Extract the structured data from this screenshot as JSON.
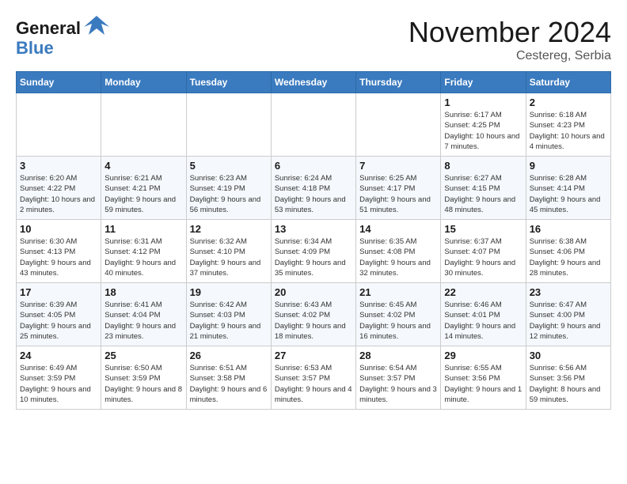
{
  "header": {
    "logo_line1": "General",
    "logo_line2": "Blue",
    "month": "November 2024",
    "location": "Cestereg, Serbia"
  },
  "days_of_week": [
    "Sunday",
    "Monday",
    "Tuesday",
    "Wednesday",
    "Thursday",
    "Friday",
    "Saturday"
  ],
  "weeks": [
    [
      {
        "num": "",
        "info": ""
      },
      {
        "num": "",
        "info": ""
      },
      {
        "num": "",
        "info": ""
      },
      {
        "num": "",
        "info": ""
      },
      {
        "num": "",
        "info": ""
      },
      {
        "num": "1",
        "info": "Sunrise: 6:17 AM\nSunset: 4:25 PM\nDaylight: 10 hours and 7 minutes."
      },
      {
        "num": "2",
        "info": "Sunrise: 6:18 AM\nSunset: 4:23 PM\nDaylight: 10 hours and 4 minutes."
      }
    ],
    [
      {
        "num": "3",
        "info": "Sunrise: 6:20 AM\nSunset: 4:22 PM\nDaylight: 10 hours and 2 minutes."
      },
      {
        "num": "4",
        "info": "Sunrise: 6:21 AM\nSunset: 4:21 PM\nDaylight: 9 hours and 59 minutes."
      },
      {
        "num": "5",
        "info": "Sunrise: 6:23 AM\nSunset: 4:19 PM\nDaylight: 9 hours and 56 minutes."
      },
      {
        "num": "6",
        "info": "Sunrise: 6:24 AM\nSunset: 4:18 PM\nDaylight: 9 hours and 53 minutes."
      },
      {
        "num": "7",
        "info": "Sunrise: 6:25 AM\nSunset: 4:17 PM\nDaylight: 9 hours and 51 minutes."
      },
      {
        "num": "8",
        "info": "Sunrise: 6:27 AM\nSunset: 4:15 PM\nDaylight: 9 hours and 48 minutes."
      },
      {
        "num": "9",
        "info": "Sunrise: 6:28 AM\nSunset: 4:14 PM\nDaylight: 9 hours and 45 minutes."
      }
    ],
    [
      {
        "num": "10",
        "info": "Sunrise: 6:30 AM\nSunset: 4:13 PM\nDaylight: 9 hours and 43 minutes."
      },
      {
        "num": "11",
        "info": "Sunrise: 6:31 AM\nSunset: 4:12 PM\nDaylight: 9 hours and 40 minutes."
      },
      {
        "num": "12",
        "info": "Sunrise: 6:32 AM\nSunset: 4:10 PM\nDaylight: 9 hours and 37 minutes."
      },
      {
        "num": "13",
        "info": "Sunrise: 6:34 AM\nSunset: 4:09 PM\nDaylight: 9 hours and 35 minutes."
      },
      {
        "num": "14",
        "info": "Sunrise: 6:35 AM\nSunset: 4:08 PM\nDaylight: 9 hours and 32 minutes."
      },
      {
        "num": "15",
        "info": "Sunrise: 6:37 AM\nSunset: 4:07 PM\nDaylight: 9 hours and 30 minutes."
      },
      {
        "num": "16",
        "info": "Sunrise: 6:38 AM\nSunset: 4:06 PM\nDaylight: 9 hours and 28 minutes."
      }
    ],
    [
      {
        "num": "17",
        "info": "Sunrise: 6:39 AM\nSunset: 4:05 PM\nDaylight: 9 hours and 25 minutes."
      },
      {
        "num": "18",
        "info": "Sunrise: 6:41 AM\nSunset: 4:04 PM\nDaylight: 9 hours and 23 minutes."
      },
      {
        "num": "19",
        "info": "Sunrise: 6:42 AM\nSunset: 4:03 PM\nDaylight: 9 hours and 21 minutes."
      },
      {
        "num": "20",
        "info": "Sunrise: 6:43 AM\nSunset: 4:02 PM\nDaylight: 9 hours and 18 minutes."
      },
      {
        "num": "21",
        "info": "Sunrise: 6:45 AM\nSunset: 4:02 PM\nDaylight: 9 hours and 16 minutes."
      },
      {
        "num": "22",
        "info": "Sunrise: 6:46 AM\nSunset: 4:01 PM\nDaylight: 9 hours and 14 minutes."
      },
      {
        "num": "23",
        "info": "Sunrise: 6:47 AM\nSunset: 4:00 PM\nDaylight: 9 hours and 12 minutes."
      }
    ],
    [
      {
        "num": "24",
        "info": "Sunrise: 6:49 AM\nSunset: 3:59 PM\nDaylight: 9 hours and 10 minutes."
      },
      {
        "num": "25",
        "info": "Sunrise: 6:50 AM\nSunset: 3:59 PM\nDaylight: 9 hours and 8 minutes."
      },
      {
        "num": "26",
        "info": "Sunrise: 6:51 AM\nSunset: 3:58 PM\nDaylight: 9 hours and 6 minutes."
      },
      {
        "num": "27",
        "info": "Sunrise: 6:53 AM\nSunset: 3:57 PM\nDaylight: 9 hours and 4 minutes."
      },
      {
        "num": "28",
        "info": "Sunrise: 6:54 AM\nSunset: 3:57 PM\nDaylight: 9 hours and 3 minutes."
      },
      {
        "num": "29",
        "info": "Sunrise: 6:55 AM\nSunset: 3:56 PM\nDaylight: 9 hours and 1 minute."
      },
      {
        "num": "30",
        "info": "Sunrise: 6:56 AM\nSunset: 3:56 PM\nDaylight: 8 hours and 59 minutes."
      }
    ]
  ]
}
